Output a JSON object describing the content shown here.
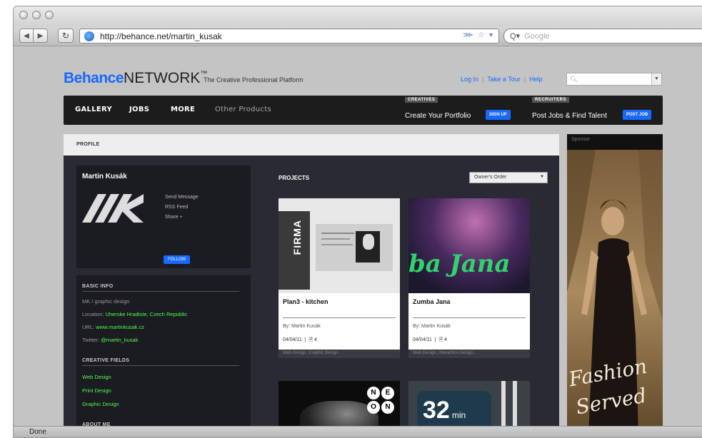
{
  "browser": {
    "url": "http://behance.net/martin_kusak",
    "search_placeholder": "Google",
    "search_prefix": "Q▾",
    "status": "Done"
  },
  "header": {
    "logo_main": "Behance",
    "logo_network": "NETWORK",
    "logo_tm": "™",
    "tagline": "The Creative Professional Platform",
    "links": [
      "Log In",
      "Take a Tour",
      "Help"
    ]
  },
  "nav": {
    "items": [
      "GALLERY",
      "JOBS",
      "MORE"
    ],
    "other": "Other Products",
    "creatives_tag": "CREATIVES",
    "creatives_text": "Create Your Portfolio",
    "signup_btn": "SIGN UP",
    "recruiters_tag": "RECRUITERS",
    "recruiters_text": "Post Jobs & Find Talent",
    "postjob_btn": "POST JOB"
  },
  "profile": {
    "bar_title": "PROFILE",
    "name": "Martin Kusák",
    "links": [
      "Send Message",
      "RSS Feed",
      "Share +"
    ],
    "follow_btn": "FOLLOW",
    "basic_info_title": "BASIC INFO",
    "role": "MK / graphic design",
    "location_label": "Location:",
    "location_value": "Uherske Hradiste, Czech Republic",
    "url_label": "URL:",
    "url_value": "www.martinkusak.cz",
    "twitter_label": "Twitter:",
    "twitter_value": "@martin_kusak",
    "creative_fields_title": "CREATIVE FIELDS",
    "creative_fields": [
      "Web Design",
      "Print Design",
      "Graphic Design"
    ],
    "about_title": "ABOUT ME"
  },
  "projects": {
    "title": "PROJECTS",
    "order": "Owner's Order",
    "items": [
      {
        "title": "Plan3 - kitchen",
        "by": "By: Martin Kusák",
        "date": "04/04/11",
        "count": "4",
        "fields": "Web Design, Graphic Design",
        "thumb_text": "FIRMA"
      },
      {
        "title": "Zumba Jana",
        "by": "By: Martin Kusák",
        "date": "04/04/11",
        "count": "4",
        "fields": "Web Design, Interaction Design...",
        "thumb_text": "ba Jana"
      }
    ],
    "third_thumb_letters": [
      "N",
      "E",
      "O",
      "N"
    ],
    "fourth_thumb_number": "32",
    "fourth_thumb_unit": "min"
  },
  "sidebar": {
    "label": "Sponsor",
    "ad_text_1": "Fashion",
    "ad_text_2": "Served"
  }
}
